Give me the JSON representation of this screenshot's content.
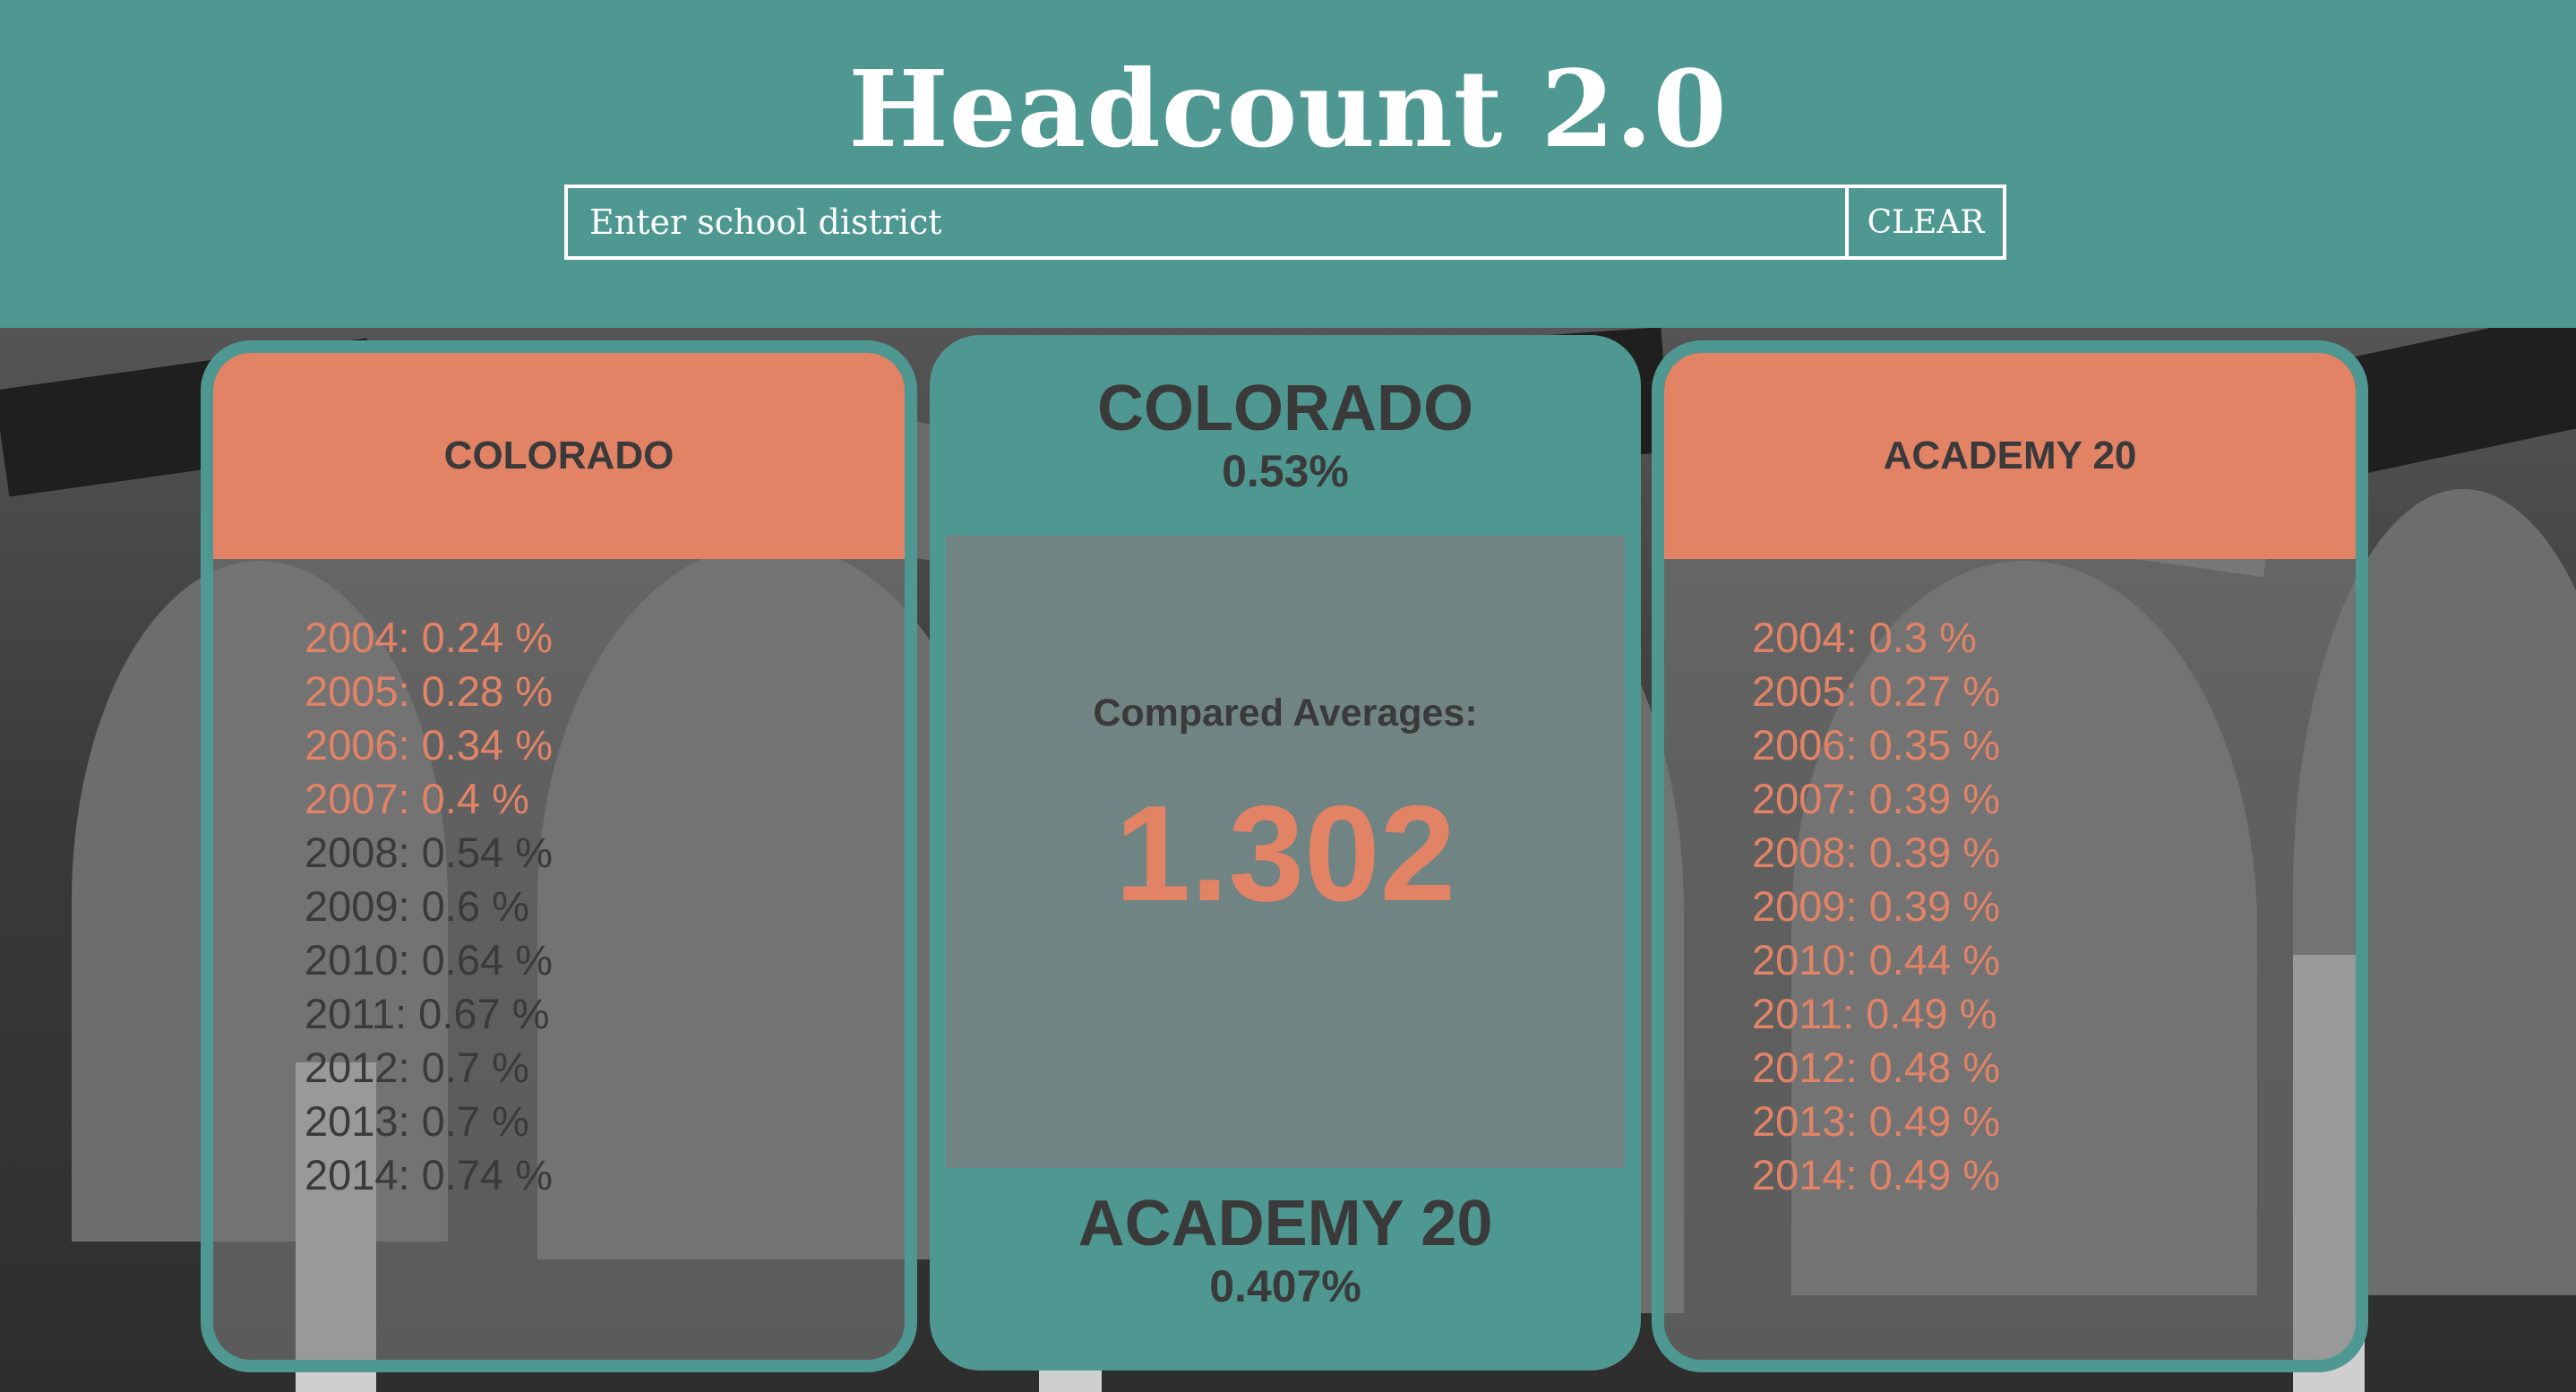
{
  "header": {
    "title": "Headcount 2.0",
    "search_placeholder": "Enter school district",
    "clear_label": "CLEAR"
  },
  "left_card": {
    "title": "COLORADO",
    "years": [
      {
        "text": "2004: 0.24 %",
        "highlight": true
      },
      {
        "text": "2005: 0.28 %",
        "highlight": true
      },
      {
        "text": "2006: 0.34 %",
        "highlight": true
      },
      {
        "text": "2007: 0.4 %",
        "highlight": true
      },
      {
        "text": "2008: 0.54 %",
        "highlight": false
      },
      {
        "text": "2009: 0.6 %",
        "highlight": false
      },
      {
        "text": "2010: 0.64 %",
        "highlight": false
      },
      {
        "text": "2011: 0.67 %",
        "highlight": false
      },
      {
        "text": "2012: 0.7 %",
        "highlight": false
      },
      {
        "text": "2013: 0.7 %",
        "highlight": false
      },
      {
        "text": "2014: 0.74 %",
        "highlight": false
      }
    ]
  },
  "comparison": {
    "top_name": "COLORADO",
    "top_average": "0.53%",
    "label": "Compared Averages:",
    "value": "1.302",
    "bottom_name": "ACADEMY 20",
    "bottom_average": "0.407%"
  },
  "right_card": {
    "title": "ACADEMY 20",
    "years": [
      {
        "text": "2004: 0.3 %",
        "highlight": true
      },
      {
        "text": "2005: 0.27 %",
        "highlight": true
      },
      {
        "text": "2006: 0.35 %",
        "highlight": true
      },
      {
        "text": "2007: 0.39 %",
        "highlight": true
      },
      {
        "text": "2008: 0.39 %",
        "highlight": true
      },
      {
        "text": "2009: 0.39 %",
        "highlight": true
      },
      {
        "text": "2010: 0.44 %",
        "highlight": true
      },
      {
        "text": "2011: 0.49 %",
        "highlight": true
      },
      {
        "text": "2012: 0.48 %",
        "highlight": true
      },
      {
        "text": "2013: 0.49 %",
        "highlight": true
      },
      {
        "text": "2014: 0.49 %",
        "highlight": true
      }
    ]
  },
  "colors": {
    "teal": "#4f9892",
    "salmon": "#e28366",
    "dark_text": "#3a3a3a"
  }
}
